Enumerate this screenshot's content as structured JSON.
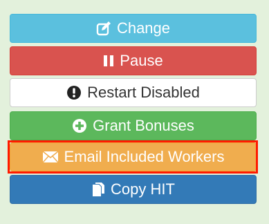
{
  "buttons": {
    "change": {
      "label": "Change",
      "icon": "edit-icon"
    },
    "pause": {
      "label": "Pause",
      "icon": "pause-icon"
    },
    "restart": {
      "label": "Restart Disabled",
      "icon": "exclamation-circle-icon"
    },
    "grant": {
      "label": "Grant Bonuses",
      "icon": "plus-circle-icon"
    },
    "email": {
      "label": "Email Included Workers",
      "icon": "envelope-icon"
    },
    "copy": {
      "label": "Copy HIT",
      "icon": "copy-icon"
    }
  },
  "colors": {
    "background": "#e3f1dc",
    "info": "#5bc0de",
    "danger": "#d9534f",
    "default": "#ffffff",
    "success": "#5cb85c",
    "warning": "#f0ad4e",
    "primary": "#337ab7",
    "highlight": "#ff1a00"
  }
}
